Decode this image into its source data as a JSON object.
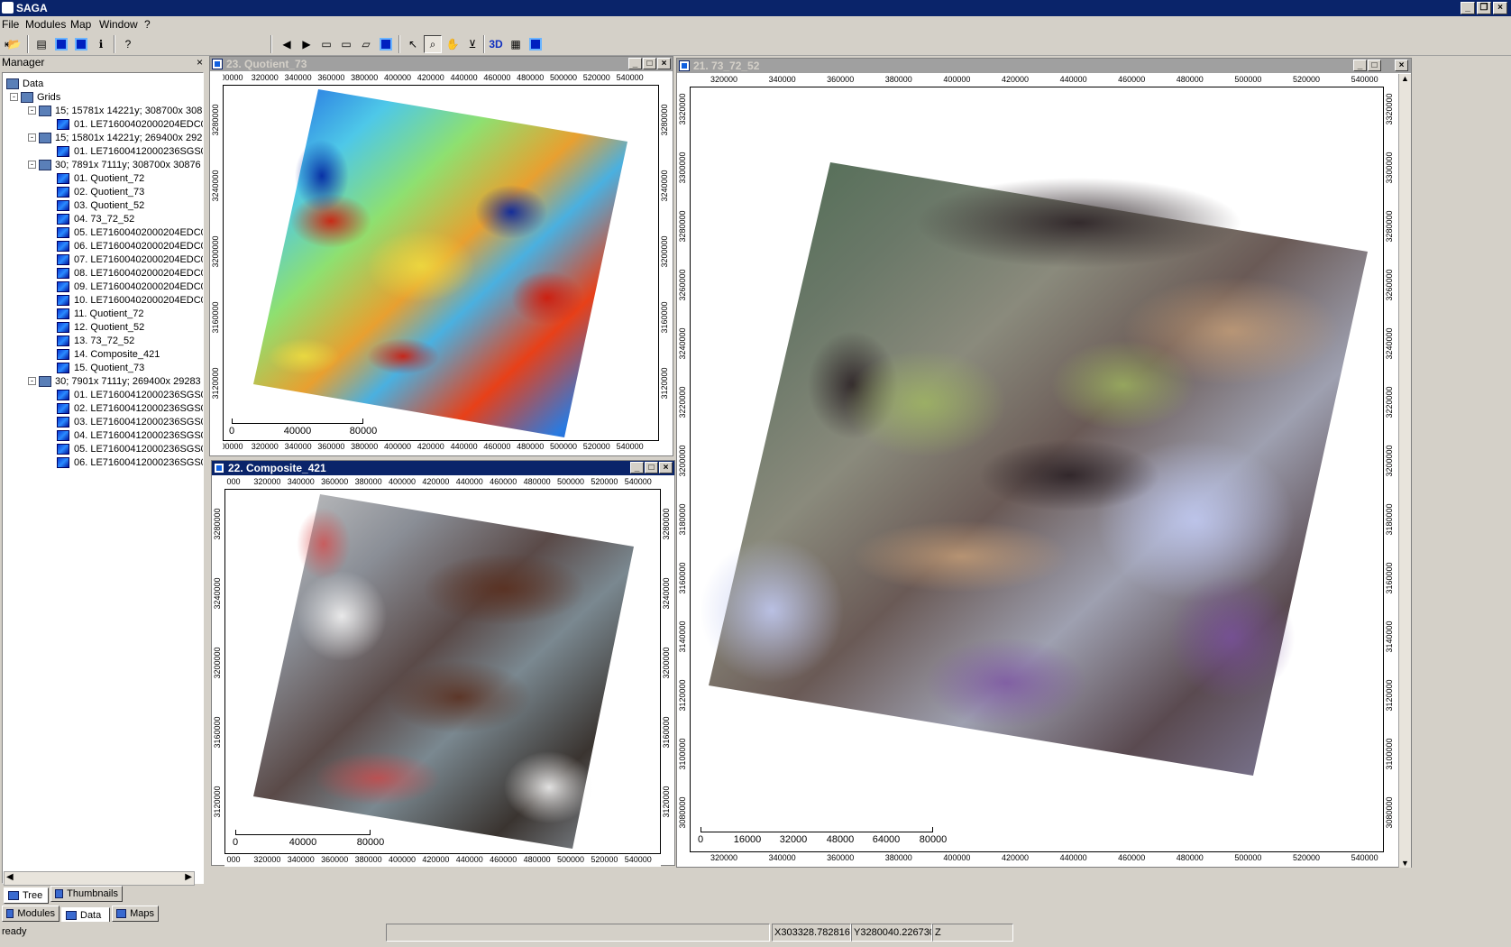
{
  "app": {
    "title": "SAGA"
  },
  "menu": [
    "File",
    "Modules",
    "Map",
    "Window",
    "?"
  ],
  "manager": {
    "title": "Manager",
    "tree": {
      "root": "Data",
      "grids_label": "Grids",
      "systems": [
        {
          "label": "15; 15781x 14221y; 308700x 308",
          "items": [
            "01. LE71600402000204EDC0("
          ]
        },
        {
          "label": "15; 15801x 14221y; 269400x 292",
          "items": [
            "01. LE71600412000236SGS00"
          ]
        },
        {
          "label": "30; 7891x 7111y; 308700x 30876",
          "items": [
            "01. Quotient_72",
            "02. Quotient_73",
            "03. Quotient_52",
            "04. 73_72_52",
            "05. LE71600402000204EDC0(",
            "06. LE71600402000204EDC0(",
            "07. LE71600402000204EDC0(",
            "08. LE71600402000204EDC0(",
            "09. LE71600402000204EDC0(",
            "10. LE71600402000204EDC0(",
            "11. Quotient_72",
            "12. Quotient_52",
            "13. 73_72_52",
            "14. Composite_421",
            "15. Quotient_73"
          ]
        },
        {
          "label": "30; 7901x 7111y; 269400x 29283",
          "items": [
            "01. LE71600412000236SGS00",
            "02. LE71600412000236SGS00",
            "03. LE71600412000236SGS00",
            "04. LE71600412000236SGS00",
            "05. LE71600412000236SGS00",
            "06. LE71600412000236SGS00"
          ]
        }
      ]
    },
    "view_tabs": [
      "Tree",
      "Thumbnails"
    ],
    "bottom_tabs": [
      "Modules",
      "Data",
      "Maps"
    ]
  },
  "maps": {
    "quotient": {
      "title": "23. Quotient_73",
      "x_ticks": [
        "00000",
        "320000",
        "340000",
        "360000",
        "380000",
        "400000",
        "420000",
        "440000",
        "460000",
        "480000",
        "500000",
        "520000",
        "540000"
      ],
      "y_ticks": [
        "3280000",
        "3240000",
        "3200000",
        "3160000",
        "3120000"
      ],
      "scale": [
        "0",
        "40000",
        "80000"
      ]
    },
    "composite": {
      "title": "22. Composite_421",
      "x_ticks": [
        "000",
        "320000",
        "340000",
        "360000",
        "380000",
        "400000",
        "420000",
        "440000",
        "460000",
        "480000",
        "500000",
        "520000",
        "540000"
      ],
      "y_ticks": [
        "3280000",
        "3240000",
        "3200000",
        "3160000",
        "3120000"
      ],
      "y_ticks_right": [
        "3280000",
        "3240000",
        "3200000",
        "3160000",
        "3120000"
      ],
      "scale": [
        "0",
        "40000",
        "80000"
      ]
    },
    "main": {
      "title": "21. 73_72_52",
      "x_ticks": [
        "320000",
        "340000",
        "360000",
        "380000",
        "400000",
        "420000",
        "440000",
        "460000",
        "480000",
        "500000",
        "520000",
        "540000"
      ],
      "y_ticks_right": [
        "3320000",
        "3300000",
        "3280000",
        "3260000",
        "3240000",
        "3220000",
        "3200000",
        "3180000",
        "3160000",
        "3140000",
        "3120000",
        "3100000",
        "3080000"
      ],
      "y_ticks_left": [
        "3320000",
        "3300000",
        "3280000",
        "3260000",
        "3240000",
        "3220000",
        "3200000",
        "3180000",
        "3160000",
        "3140000",
        "3120000",
        "3100000",
        "3080000"
      ],
      "scale": [
        "0",
        "16000",
        "32000",
        "48000",
        "64000",
        "80000"
      ]
    }
  },
  "status": {
    "text": "ready",
    "x": "X303328.782816",
    "y": "Y3280040.226730",
    "z": "Z"
  },
  "colors": {
    "titlebar": "#0a246a",
    "background": "#d4d0c8"
  }
}
